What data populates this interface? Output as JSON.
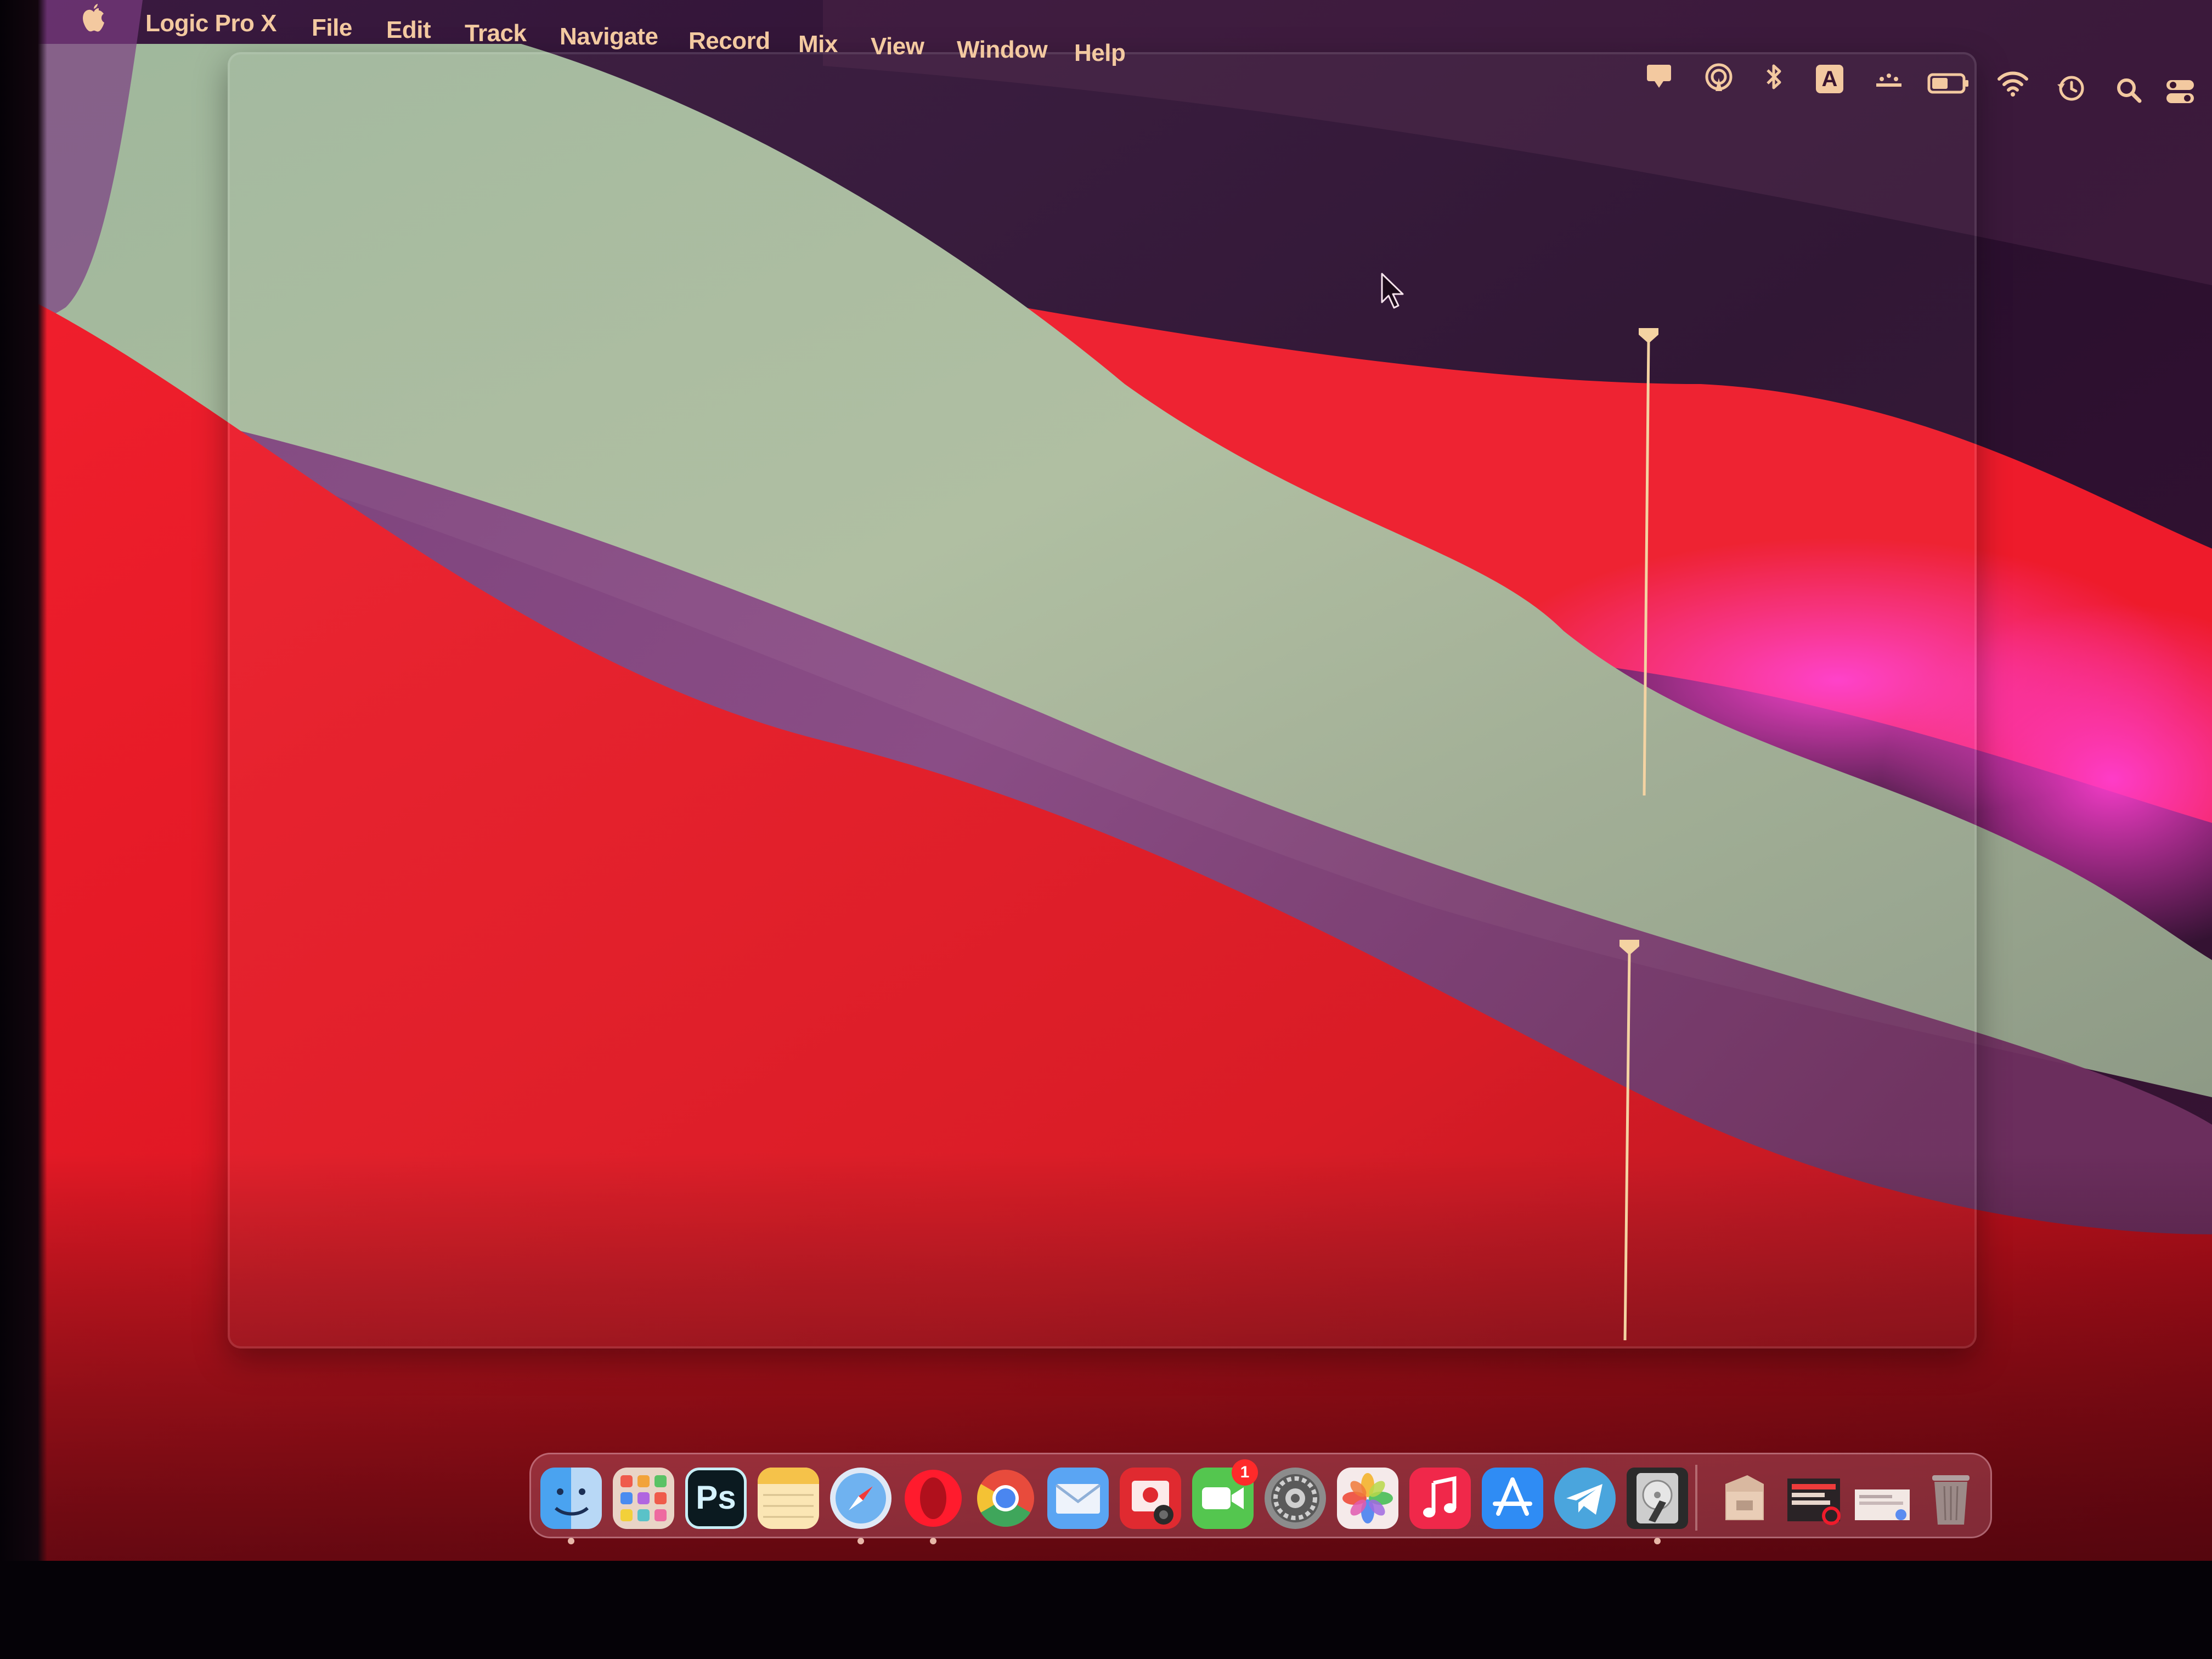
{
  "app_menu": {
    "apple_icon": "apple-logo-icon",
    "app_name": "Logic Pro X",
    "items": [
      "File",
      "Edit",
      "Track",
      "Navigate",
      "Record",
      "Mix",
      "View",
      "Window",
      "Help"
    ]
  },
  "status_bar": {
    "icons": [
      "notification-flag-icon",
      "airdrop-icon",
      "bluetooth-icon",
      "input-source-icon",
      "display-icon",
      "battery-icon",
      "wifi-icon",
      "time-machine-icon",
      "spotlight-search-icon",
      "control-center-icon"
    ],
    "input_source_letter": "A"
  },
  "dock": {
    "apps": [
      {
        "name": "finder-icon",
        "running": true
      },
      {
        "name": "launchpad-icon",
        "running": false
      },
      {
        "name": "photoshop-icon",
        "label": "Ps",
        "running": false
      },
      {
        "name": "notes-icon",
        "running": false
      },
      {
        "name": "safari-icon",
        "running": true
      },
      {
        "name": "opera-icon",
        "running": true
      },
      {
        "name": "chrome-icon",
        "running": false
      },
      {
        "name": "mail-icon",
        "running": false
      },
      {
        "name": "photo-booth-icon",
        "running": false
      },
      {
        "name": "facetime-icon",
        "running": false,
        "badge": "1"
      },
      {
        "name": "system-preferences-icon",
        "running": false
      },
      {
        "name": "photos-icon",
        "running": false
      },
      {
        "name": "music-icon",
        "running": false
      },
      {
        "name": "app-store-icon",
        "running": false
      },
      {
        "name": "telegram-icon",
        "running": false
      },
      {
        "name": "disk-utility-icon",
        "running": true
      }
    ],
    "right_items": [
      "downloads-stack-icon",
      "calendar-stack-icon",
      "documents-stack-icon",
      "trash-icon"
    ]
  },
  "colors": {
    "menu_text": "#f3c9a0",
    "wallpaper_red": "#ee1b2b",
    "wallpaper_purple": "#3c1a3a",
    "wallpaper_sage": "#a7bba0",
    "marker": "#f4d3a2"
  }
}
